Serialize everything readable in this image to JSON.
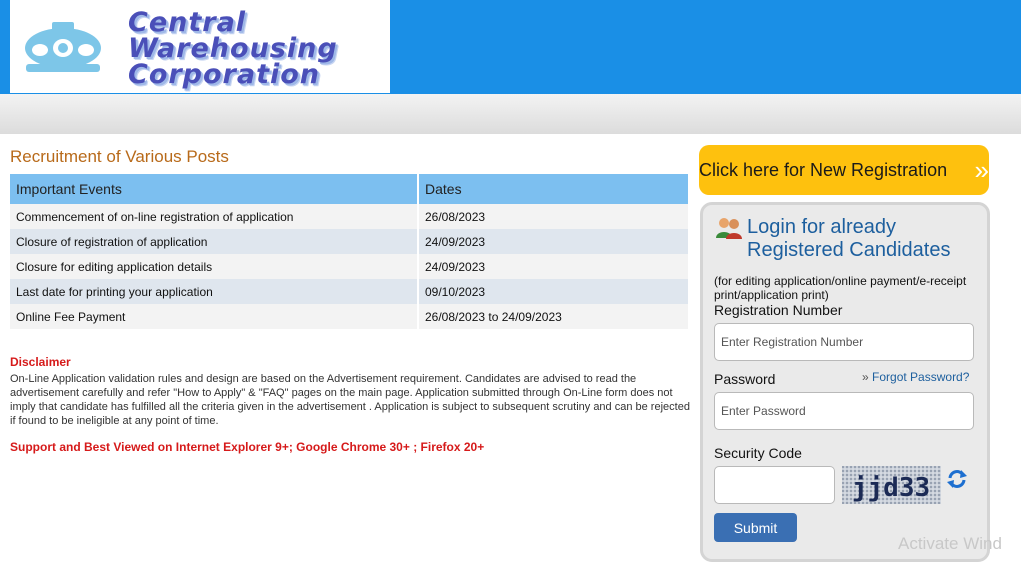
{
  "header": {
    "logo_lines": [
      "Central",
      "Warehousing",
      "Corporation"
    ]
  },
  "page": {
    "title": "Recruitment of Various Posts"
  },
  "events_table": {
    "headers": [
      "Important Events",
      "Dates"
    ],
    "rows": [
      {
        "event": "Commencement of on-line registration of application",
        "date": "26/08/2023"
      },
      {
        "event": "Closure of registration of application",
        "date": "24/09/2023"
      },
      {
        "event": "Closure for editing application details",
        "date": "24/09/2023"
      },
      {
        "event": "Last date for printing your application",
        "date": "09/10/2023"
      },
      {
        "event": "Online Fee Payment",
        "date": "26/08/2023 to 24/09/2023"
      }
    ]
  },
  "disclaimer": {
    "title": "Disclaimer",
    "text": "On-Line Application validation rules and design are based on the Advertisement requirement. Candidates are advised to read the advertisement carefully and refer \"How to Apply\" & \"FAQ\" pages on the main page. Application submitted through On-Line form does not imply that candidate has fulfilled all the criteria given in the advertisement . Application is subject to subsequent scrutiny and can be rejected if found to be ineligible at any point of time.",
    "support_note": "Support and Best Viewed on Internet Explorer 9+; Google Chrome 30+ ; Firefox 20+"
  },
  "new_registration": {
    "label": "Click here for New Registration",
    "arrow": "»"
  },
  "login": {
    "heading_line1": "Login for already",
    "heading_line2": "Registered Candidates",
    "note": "(for editing application/online payment/e-receipt print/application print)",
    "registration_label": "Registration Number",
    "registration_placeholder": "Enter Registration Number",
    "password_label": "Password",
    "password_placeholder": "Enter Password",
    "forgot_label": "Forgot Password?",
    "security_label": "Security Code",
    "captcha_text": "jjd33",
    "submit_label": "Submit"
  },
  "watermark": "Activate Wind",
  "colors": {
    "header_blue": "#1a8fe6",
    "title_orange": "#b86a1a",
    "table_header": "#7cbff0",
    "alert_red": "#d61a1a",
    "new_reg_yellow": "#fec10e",
    "link_blue": "#1d5f9e",
    "submit_blue": "#3a6fb3"
  },
  "icons": [
    "cwc-logo-emblem",
    "users-icon",
    "double-chevron-icon",
    "refresh-icon"
  ]
}
